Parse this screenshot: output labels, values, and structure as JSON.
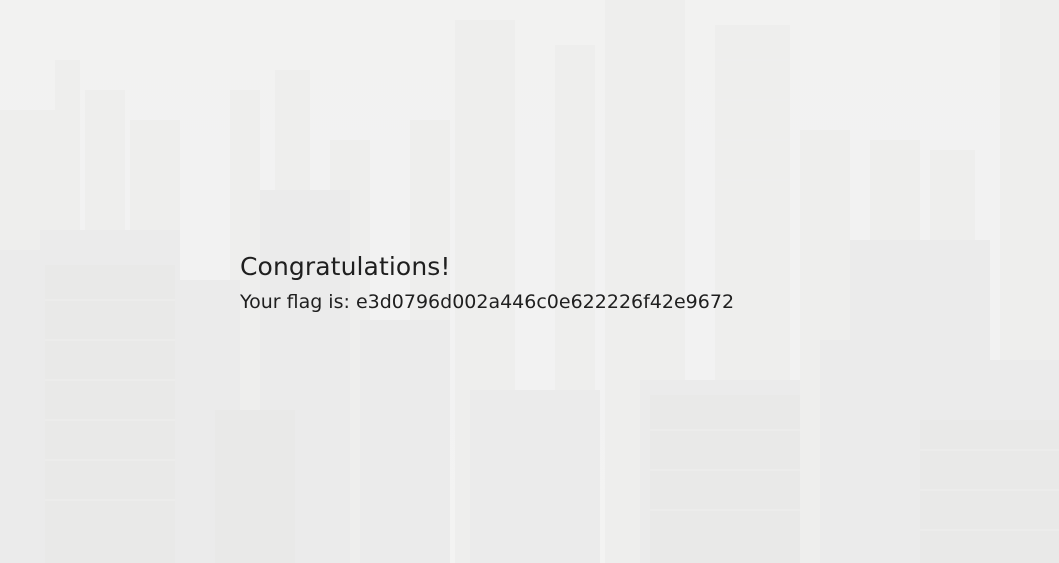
{
  "message": {
    "title": "Congratulations!",
    "flag_prefix": "Your flag is:",
    "flag_value": "e3d0796d002a446c0e622226f42e9672"
  }
}
